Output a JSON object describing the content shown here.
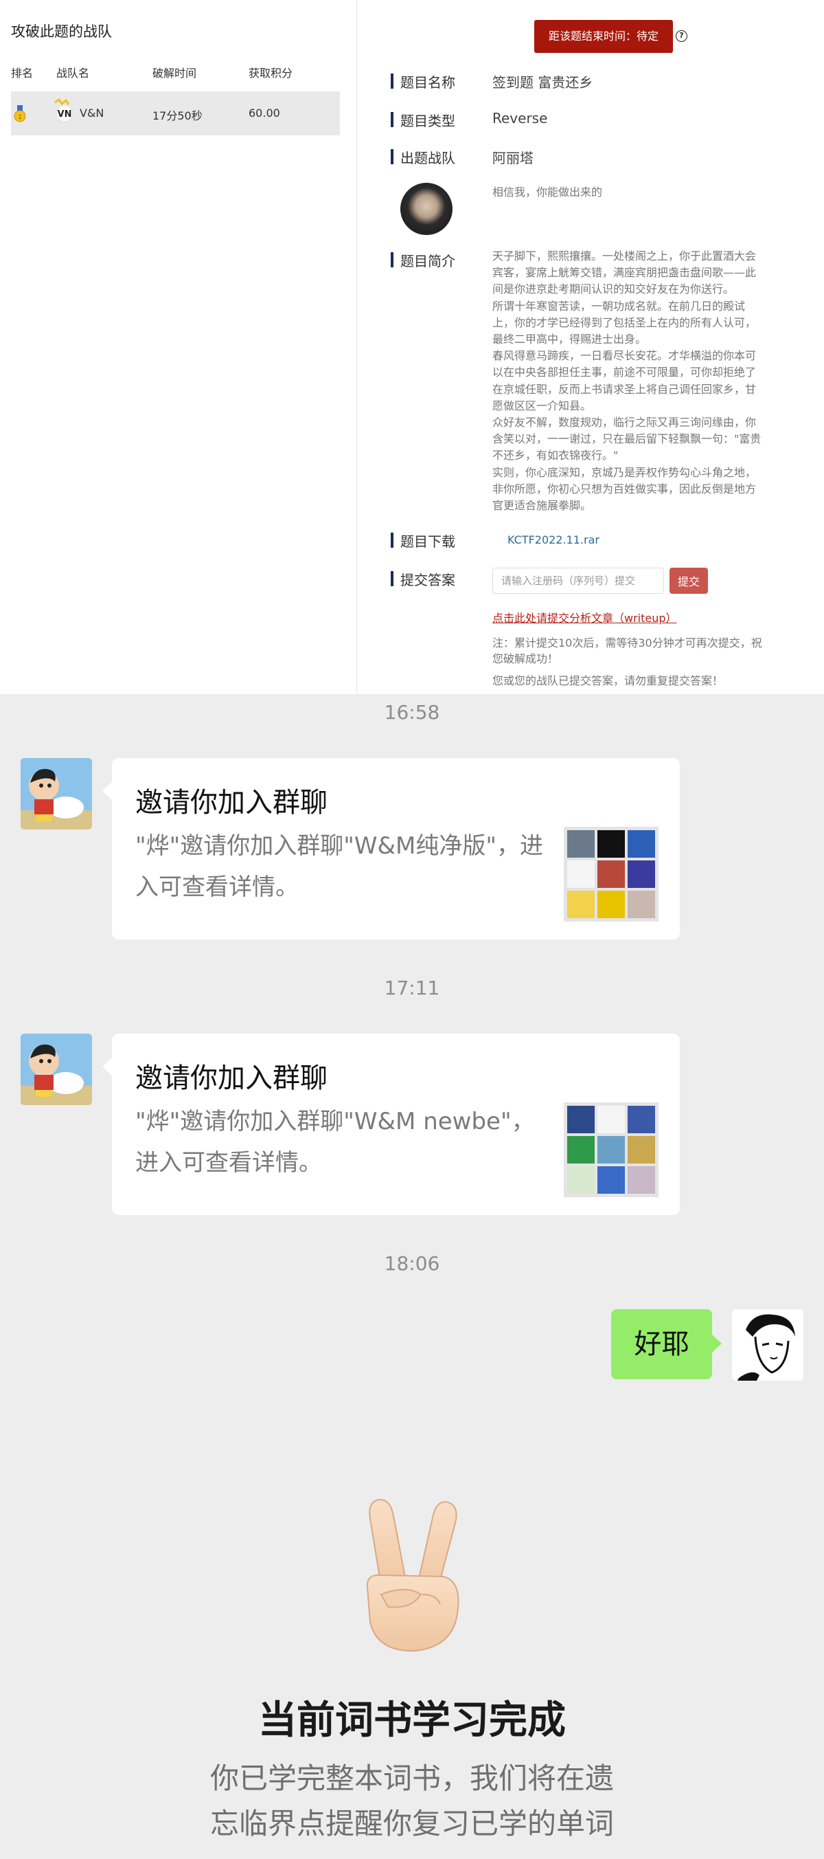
{
  "ctf": {
    "left": {
      "title": "攻破此题的战队",
      "columns": [
        "排名",
        "战队名",
        "破解时间",
        "获取积分"
      ],
      "row": {
        "team": "V&N",
        "time": "17分50秒",
        "score": "60.00"
      }
    },
    "right": {
      "timer_label": "距该题结束时间：待定",
      "help_icon": "question-circle-icon",
      "fields": {
        "name_label": "题目名称",
        "name_value": "签到题 富贵还乡",
        "type_label": "题目类型",
        "type_value": "Reverse",
        "team_label": "出题战队",
        "team_value": "阿丽塔",
        "author_quote": "相信我，你能做出来的",
        "intro_label": "题目简介",
        "intro_lines": [
          "天子脚下，熙熙攘攘。一处楼阁之上，你于此置酒大会",
          "宾客，宴席上觥筹交错，满座宾朋把盏击盘间歌——此",
          "间是你进京赴考期间认识的知交好友在为你送行。",
          "所谓十年寒窗苦读，一朝功成名就。在前几日的殿试",
          "上，你的才学已经得到了包括圣上在内的所有人认可，",
          "最终二甲高中，得赐进士出身。",
          "春风得意马蹄疾，一日看尽长安花。才华横溢的你本可",
          "以在中央各部担任主事，前途不可限量，可你却拒绝了",
          "在京城任职，反而上书请求圣上将自己调任回家乡，甘",
          "愿做区区一介知县。",
          "众好友不解，数度规劝，临行之际又再三询问缘由，你",
          "含笑以对，一一谢过，只在最后留下轻飘飘一句：\"富贵",
          "不还乡，有如衣锦夜行。\"",
          "实则，你心底深知，京城乃是弄权作势勾心斗角之地，",
          "非你所愿，你初心只想为百姓做实事，因此反倒是地方",
          "官更适合施展拳脚。"
        ],
        "download_label": "题目下载",
        "download_file": "KCTF2022.11.rar",
        "submit_label": "提交答案",
        "input_placeholder": "请输入注册码（序列号）提交",
        "submit_button": "提交",
        "writeup_link": "点击此处请提交分析文章（writeup）",
        "note_lines": [
          "注：累计提交10次后，需等待30分钟才可再次提交，祝",
          "您破解成功！"
        ],
        "note_extra": "您或您的战队已提交答案，请勿重复提交答案！"
      }
    }
  },
  "chat": {
    "messages": [
      {
        "time": "16:58",
        "title": "邀请你加入群聊",
        "desc": "\"烨\"邀请你加入群聊\"W&M纯净版\"，进入可查看详情。",
        "avatar_icon": "cartoon-boy-avatar-icon"
      },
      {
        "time": "17:11",
        "title": "邀请你加入群聊",
        "desc": "\"烨\"邀请你加入群聊\"W&M newbe\"，进入可查看详情。",
        "avatar_icon": "cartoon-boy-avatar-icon"
      }
    ],
    "reply_time": "18:06",
    "reply_text": "好耶"
  },
  "finish": {
    "icon": "victory-hand-icon",
    "title": "当前词书学习完成",
    "sub_lines": [
      "你已学完整本词书，我们将在遗",
      "忘临界点提醒你复习已学的单词"
    ]
  },
  "colors": {
    "timer_bg": "#a8170b",
    "submit_bg": "#c9554d",
    "bubble_green": "#95ec69",
    "chat_bg": "#ededed"
  }
}
